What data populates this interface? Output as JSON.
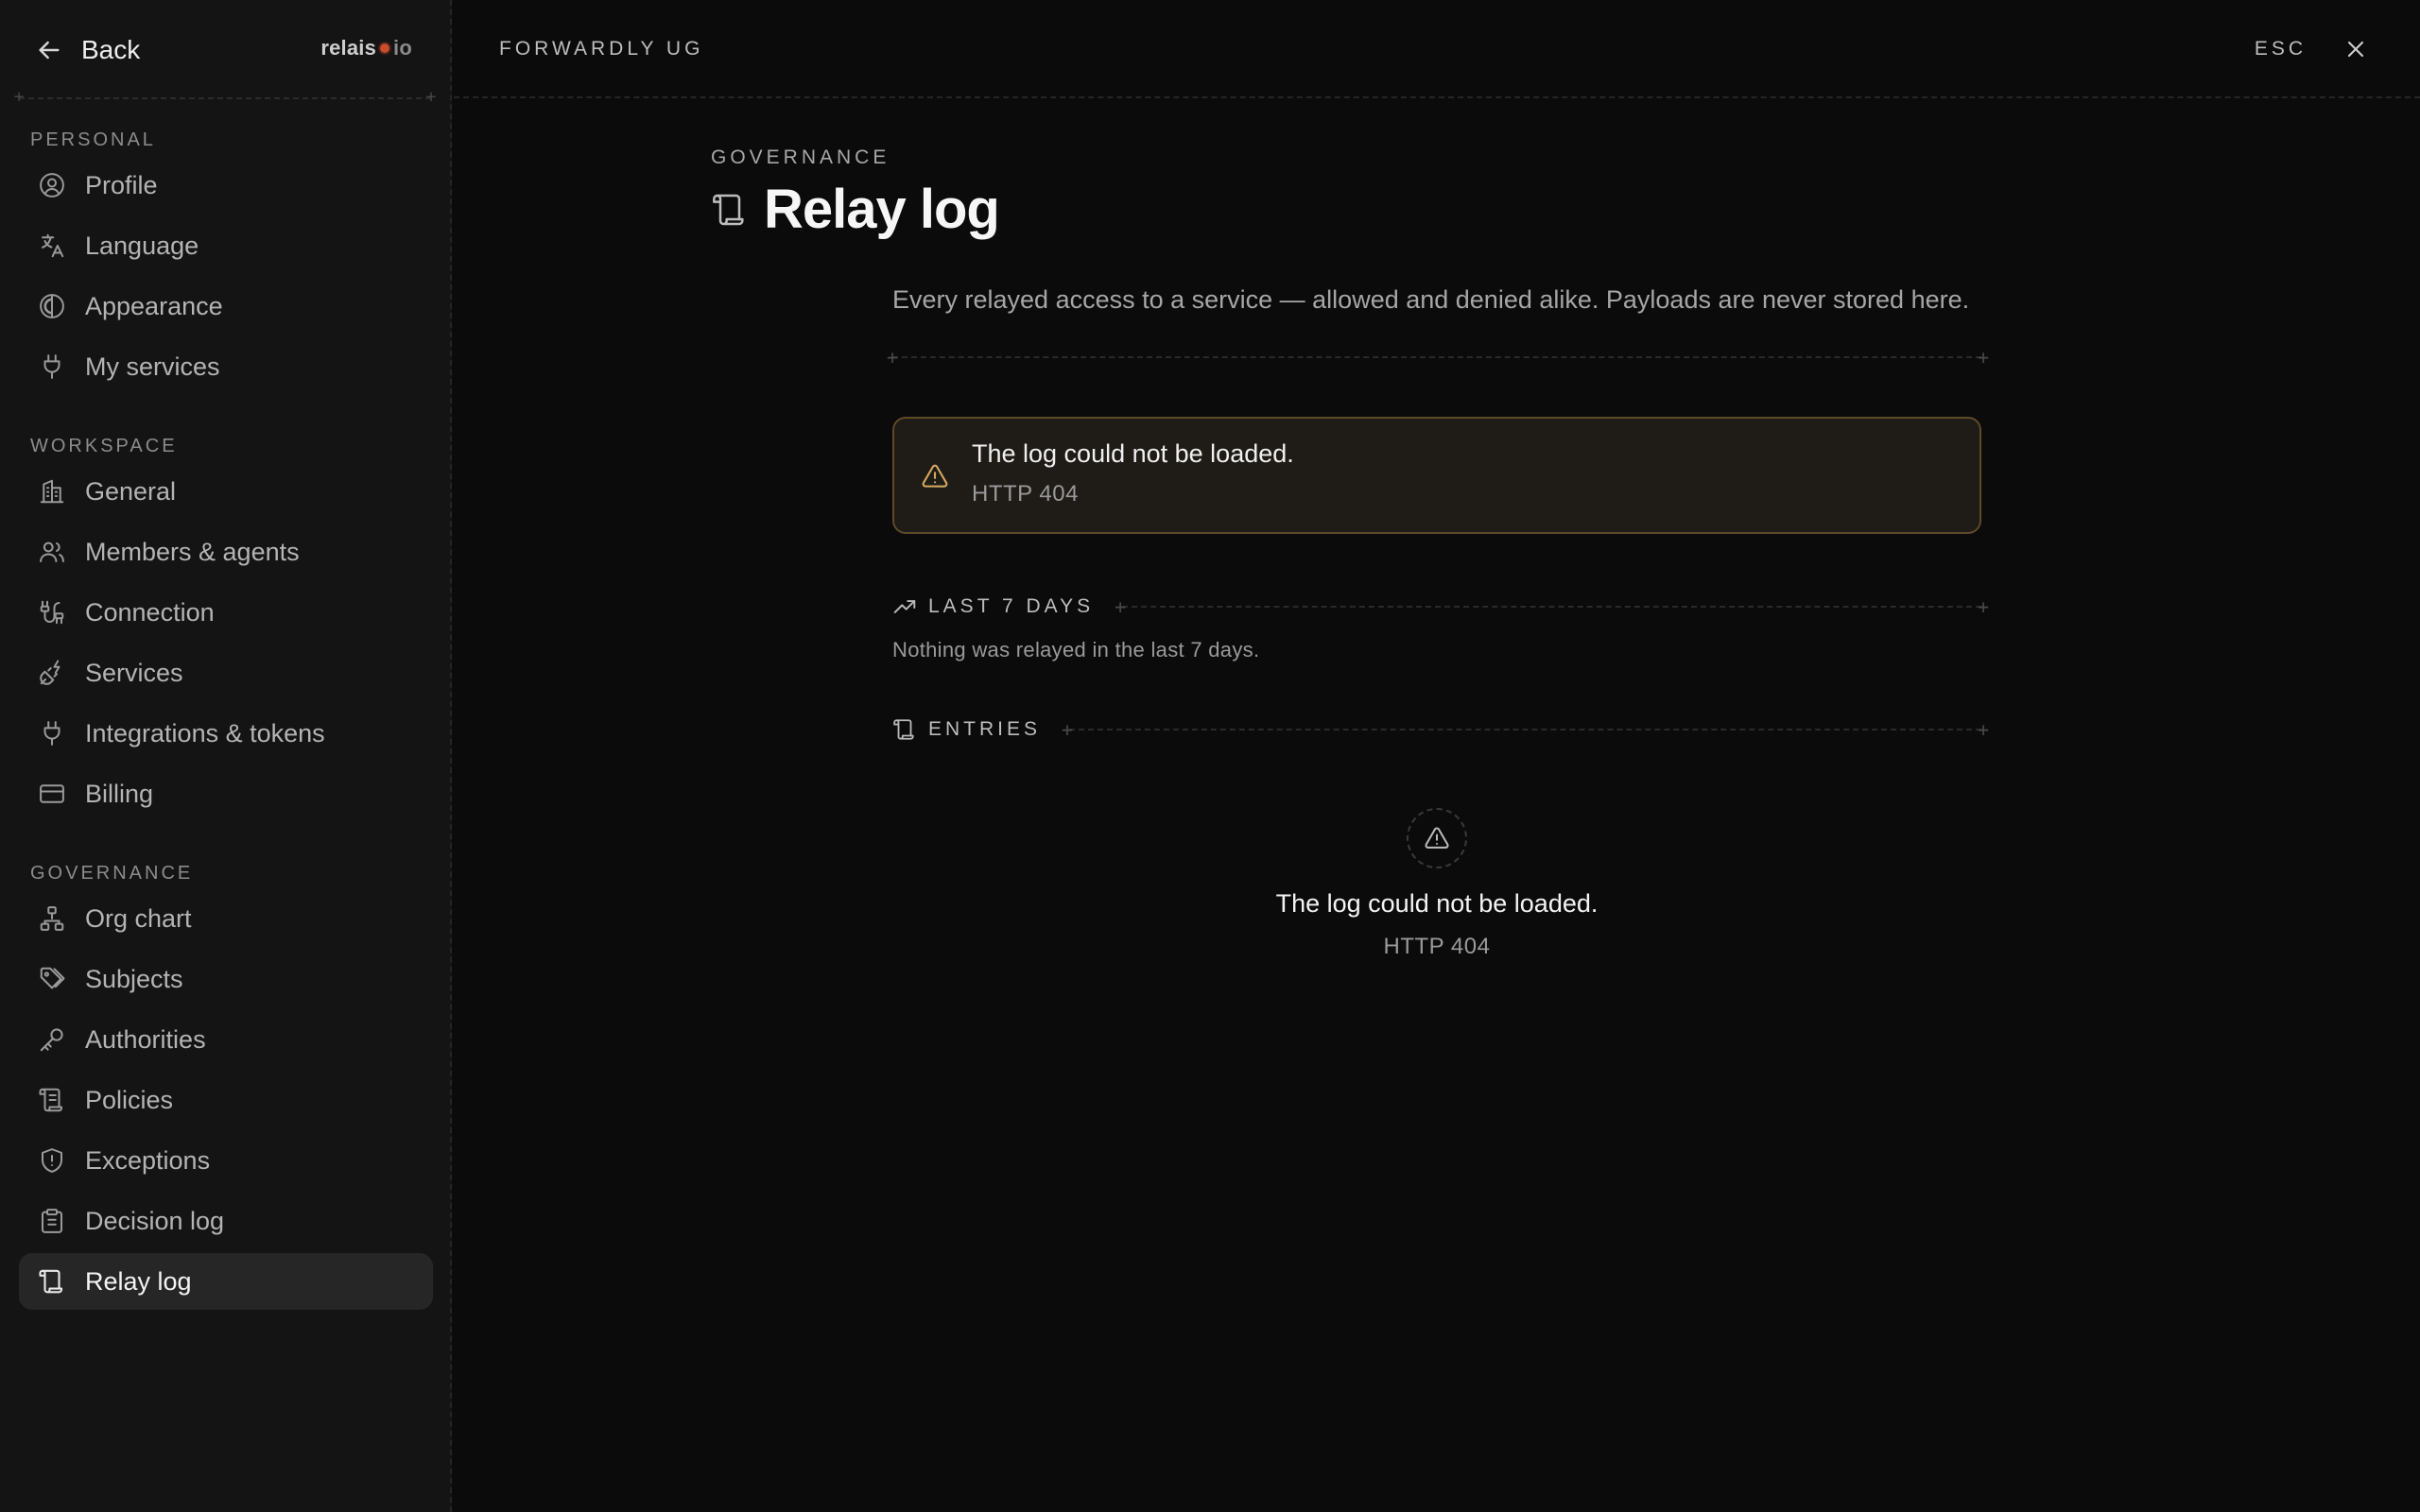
{
  "header": {
    "back_label": "Back",
    "logo": {
      "part1": "relais",
      "part2": "io",
      "dot_color": "#c94c2c"
    },
    "org_name": "FORWARDLY UG",
    "esc_label": "ESC"
  },
  "sidebar": {
    "sections": [
      {
        "label": "PERSONAL",
        "items": [
          {
            "label": "Profile",
            "icon": "user-circle-icon"
          },
          {
            "label": "Language",
            "icon": "translate-icon"
          },
          {
            "label": "Appearance",
            "icon": "contrast-icon"
          },
          {
            "label": "My services",
            "icon": "plug-icon"
          }
        ]
      },
      {
        "label": "WORKSPACE",
        "items": [
          {
            "label": "General",
            "icon": "building-icon"
          },
          {
            "label": "Members & agents",
            "icon": "users-icon"
          },
          {
            "label": "Connection",
            "icon": "cable-icon"
          },
          {
            "label": "Services",
            "icon": "plug-zap-icon"
          },
          {
            "label": "Integrations & tokens",
            "icon": "plug-icon"
          },
          {
            "label": "Billing",
            "icon": "credit-card-icon"
          }
        ]
      },
      {
        "label": "GOVERNANCE",
        "items": [
          {
            "label": "Org chart",
            "icon": "network-icon"
          },
          {
            "label": "Subjects",
            "icon": "tags-icon"
          },
          {
            "label": "Authorities",
            "icon": "key-icon"
          },
          {
            "label": "Policies",
            "icon": "scroll-text-icon"
          },
          {
            "label": "Exceptions",
            "icon": "shield-alert-icon"
          },
          {
            "label": "Decision log",
            "icon": "clipboard-icon"
          },
          {
            "label": "Relay log",
            "icon": "scroll-icon",
            "active": true
          }
        ]
      }
    ]
  },
  "main": {
    "eyebrow": "GOVERNANCE",
    "title": "Relay log",
    "description": "Every relayed access to a service — allowed and denied alike. Payloads are never stored here.",
    "alert": {
      "title": "The log could not be loaded.",
      "detail": "HTTP 404",
      "border_color": "#5e4a28",
      "icon_color": "#d3a861"
    },
    "trend": {
      "label": "LAST 7 DAYS",
      "empty_text": "Nothing was relayed in the last 7 days."
    },
    "entries": {
      "label": "ENTRIES",
      "empty_title": "The log could not be loaded.",
      "empty_detail": "HTTP 404"
    }
  }
}
